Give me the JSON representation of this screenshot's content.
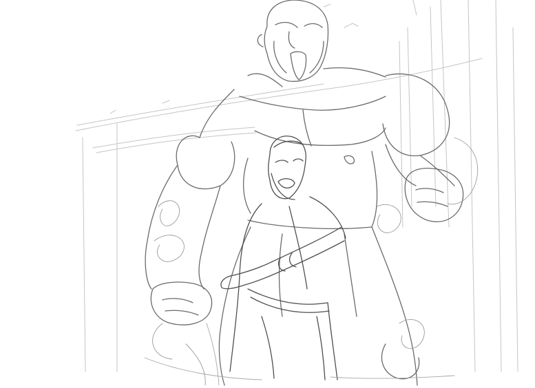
{
  "image": {
    "paper_color": "#ffffff",
    "pencil_color": "#5a5a5a",
    "light_pencil_color": "#b4b4b4"
  }
}
